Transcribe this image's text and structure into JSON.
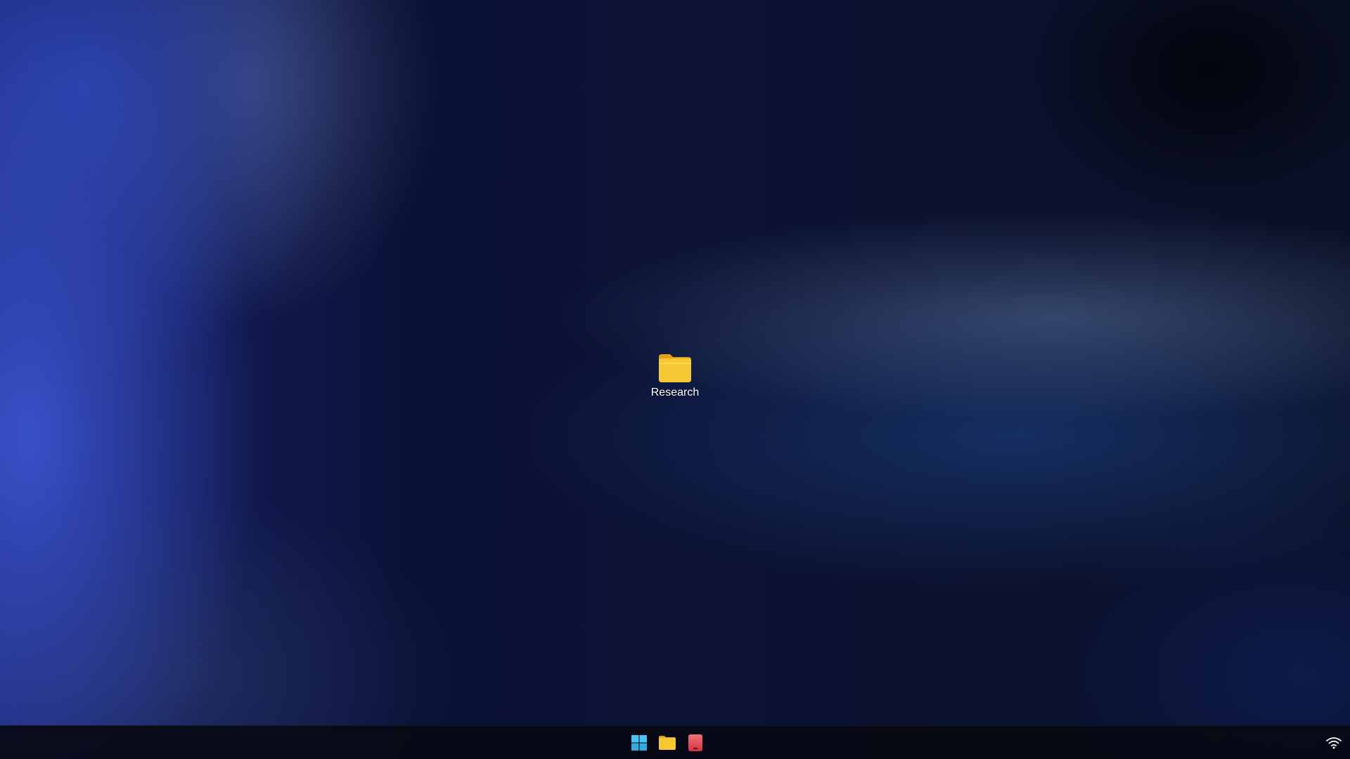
{
  "desktop": {
    "icons": [
      {
        "label": "Research",
        "icon": "folder-icon"
      }
    ]
  },
  "taskbar": {
    "pinned": [
      {
        "icon": "windows-start-icon"
      },
      {
        "icon": "file-explorer-folder-icon"
      },
      {
        "icon": "red-app-icon"
      }
    ],
    "tray": [
      {
        "icon": "wifi-icon"
      }
    ]
  },
  "colors": {
    "folder": "#f5c02e",
    "folder_highlight": "#ffd95a",
    "windows_logo": "#4cc2f0",
    "red_app": "#e8454f",
    "taskbar_bg": "#080a14"
  }
}
